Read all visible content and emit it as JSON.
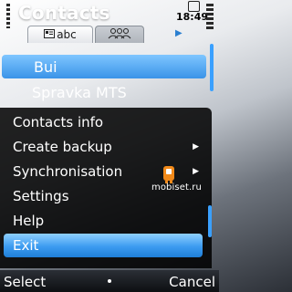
{
  "app": {
    "title": "Contacts",
    "time": "18:49"
  },
  "tabs": [
    {
      "label": "abc",
      "icon": "contact-card-icon",
      "active": true
    },
    {
      "label": "",
      "icon": "group-people-icon",
      "active": false
    }
  ],
  "list": {
    "items": [
      {
        "label": "Bui",
        "highlighted": true
      },
      {
        "label": "Spravka MTS",
        "highlighted": false
      }
    ]
  },
  "menu": {
    "items": [
      {
        "label": "Contacts info",
        "submenu": false,
        "selected": false
      },
      {
        "label": "Create backup",
        "submenu": true,
        "selected": false
      },
      {
        "label": "Synchronisation",
        "submenu": true,
        "selected": false
      },
      {
        "label": "Settings",
        "submenu": false,
        "selected": false
      },
      {
        "label": "Help",
        "submenu": false,
        "selected": false
      },
      {
        "label": "Exit",
        "submenu": false,
        "selected": true
      }
    ]
  },
  "watermark": "mobiset.ru",
  "softkeys": {
    "left": "Select",
    "right": "Cancel"
  },
  "colors": {
    "accent": "#3a93e8",
    "menu_background": "#000000"
  }
}
